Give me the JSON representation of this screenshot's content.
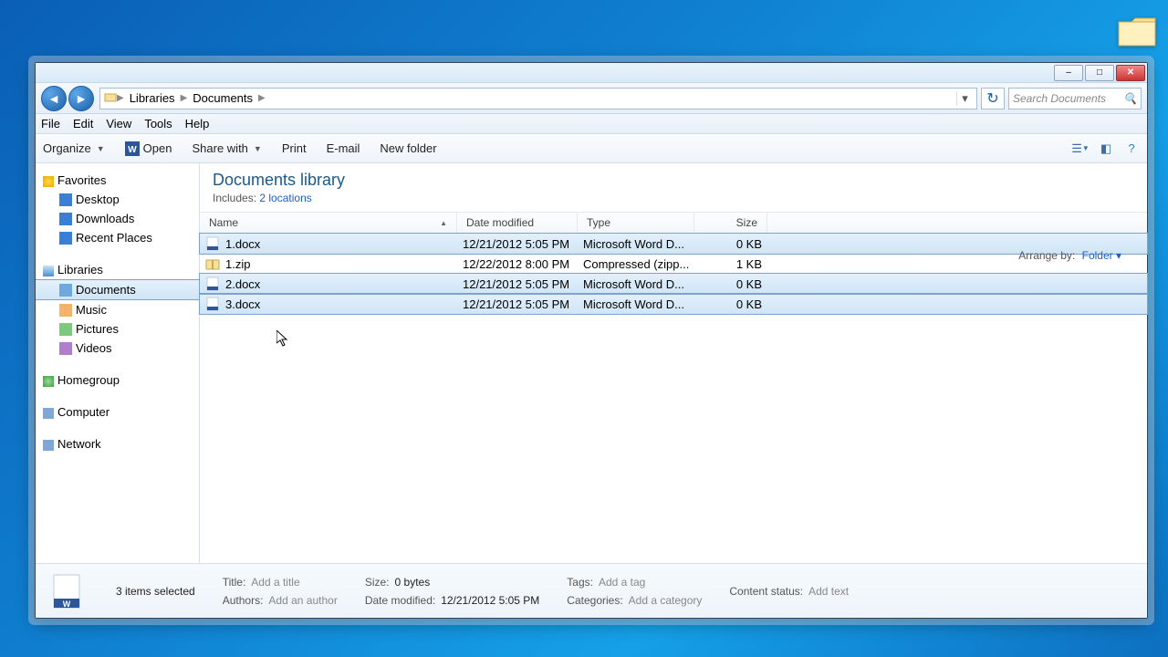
{
  "desktop": {
    "folder_visible": true
  },
  "window": {
    "controls": {
      "min": "–",
      "max": "□",
      "close": "✕"
    }
  },
  "address": {
    "segments": [
      "Libraries",
      "Documents"
    ]
  },
  "search": {
    "placeholder": "Search Documents"
  },
  "menus": [
    "File",
    "Edit",
    "View",
    "Tools",
    "Help"
  ],
  "toolbar": {
    "organize": "Organize",
    "open": "Open",
    "share": "Share with",
    "print": "Print",
    "email": "E-mail",
    "newfolder": "New folder"
  },
  "sidebar": {
    "favorites": {
      "label": "Favorites",
      "items": [
        "Desktop",
        "Downloads",
        "Recent Places"
      ]
    },
    "libraries": {
      "label": "Libraries",
      "items": [
        "Documents",
        "Music",
        "Pictures",
        "Videos"
      ],
      "selected": "Documents"
    },
    "homegroup": "Homegroup",
    "computer": "Computer",
    "network": "Network"
  },
  "library": {
    "title": "Documents library",
    "includes_label": "Includes:",
    "includes_link": "2 locations",
    "arrange_label": "Arrange by:",
    "arrange_value": "Folder"
  },
  "columns": {
    "name": "Name",
    "date": "Date modified",
    "type": "Type",
    "size": "Size"
  },
  "files": [
    {
      "name": "1.docx",
      "date": "12/21/2012 5:05 PM",
      "type": "Microsoft Word D...",
      "size": "0 KB",
      "icon": "docx",
      "selected": true
    },
    {
      "name": "1.zip",
      "date": "12/22/2012 8:00 PM",
      "type": "Compressed (zipp...",
      "size": "1 KB",
      "icon": "zip",
      "selected": false
    },
    {
      "name": "2.docx",
      "date": "12/21/2012 5:05 PM",
      "type": "Microsoft Word D...",
      "size": "0 KB",
      "icon": "docx",
      "selected": true
    },
    {
      "name": "3.docx",
      "date": "12/21/2012 5:05 PM",
      "type": "Microsoft Word D...",
      "size": "0 KB",
      "icon": "docx",
      "selected": true
    }
  ],
  "details": {
    "status": "3 items selected",
    "title_k": "Title:",
    "title_v": "Add a title",
    "authors_k": "Authors:",
    "authors_v": "Add an author",
    "size_k": "Size:",
    "size_v": "0 bytes",
    "datemod_k": "Date modified:",
    "datemod_v": "12/21/2012 5:05 PM",
    "tags_k": "Tags:",
    "tags_v": "Add a tag",
    "cats_k": "Categories:",
    "cats_v": "Add a category",
    "cstatus_k": "Content status:",
    "cstatus_v": "Add text"
  }
}
